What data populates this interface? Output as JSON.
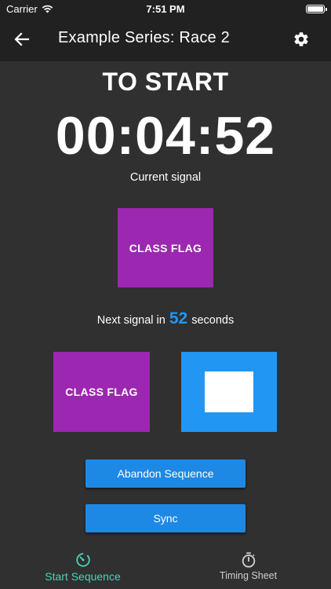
{
  "status_bar": {
    "carrier": "Carrier",
    "time": "7:51 PM"
  },
  "app_bar": {
    "title": "Example Series: Race 2"
  },
  "sequence": {
    "phase": "TO START",
    "timer": "00:04:52",
    "current_signal_label": "Current signal",
    "current_flag": "CLASS FLAG",
    "next_signal_prefix": "Next signal in",
    "next_signal_seconds": "52",
    "next_signal_suffix": "seconds",
    "next_flags": [
      {
        "label": "CLASS FLAG",
        "color": "#9c27b0"
      },
      {
        "label": "",
        "color": "#2196f3"
      }
    ]
  },
  "buttons": {
    "abandon": "Abandon Sequence",
    "sync": "Sync"
  },
  "bottom_nav": {
    "items": [
      {
        "label": "Start Sequence",
        "icon": "start-sequence-icon",
        "active": true
      },
      {
        "label": "Timing Sheet",
        "icon": "stopwatch-icon",
        "active": false
      }
    ]
  },
  "colors": {
    "background": "#303030",
    "app_bar": "#212121",
    "class_flag": "#9c27b0",
    "blue_flag": "#2196f3",
    "button": "#1e88e5",
    "accent": "#4dd0b8"
  }
}
